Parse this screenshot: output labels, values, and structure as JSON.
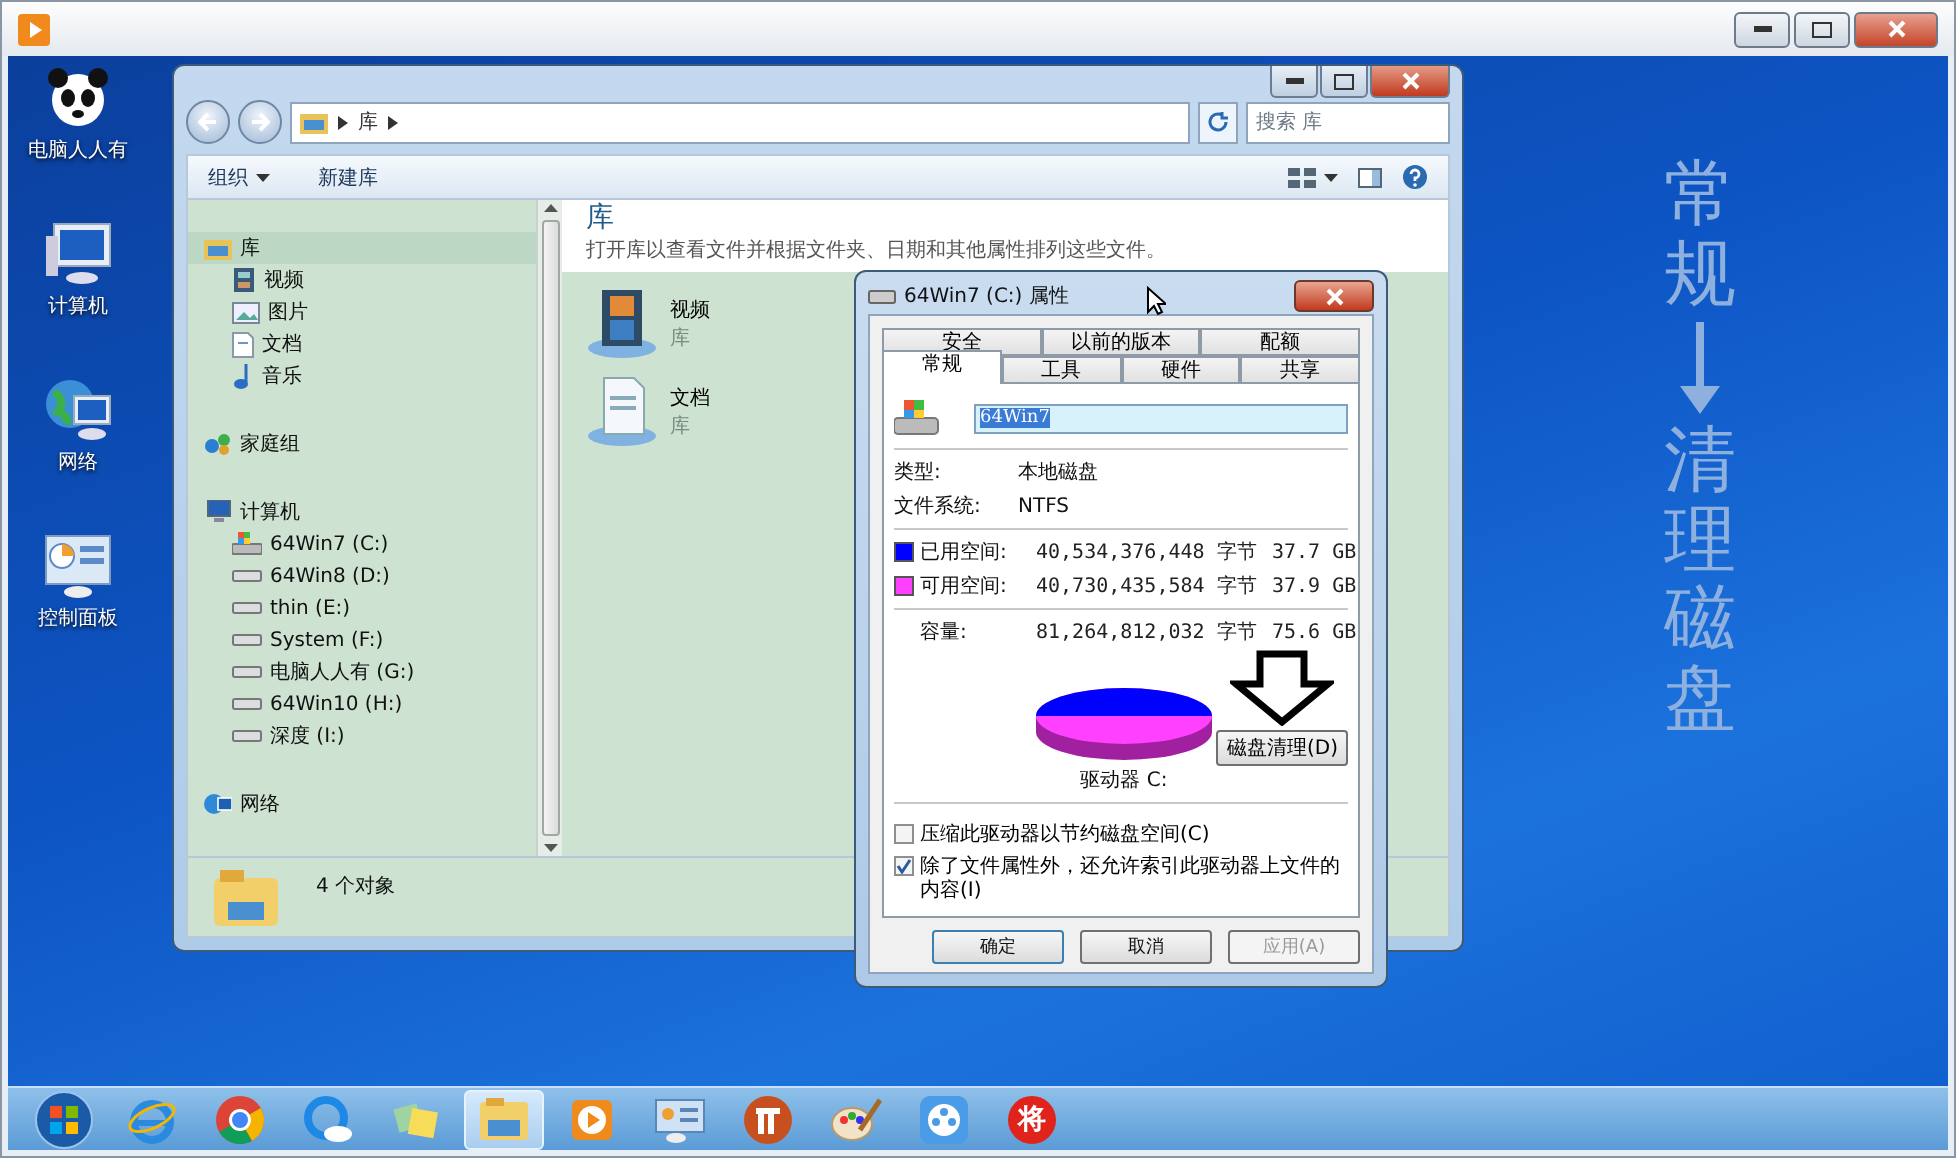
{
  "desktop": {
    "icons": [
      {
        "label": "电脑人人有",
        "kind": "panda"
      },
      {
        "label": "计算机",
        "kind": "computer"
      },
      {
        "label": "网络",
        "kind": "network"
      },
      {
        "label": "控制面板",
        "kind": "control-panel"
      }
    ],
    "caption": {
      "top": "常规",
      "bottom": "清理磁盘"
    }
  },
  "explorer": {
    "breadcrumb": [
      "库"
    ],
    "search": {
      "placeholder": "搜索 库"
    },
    "toolbar": [
      {
        "label": "组织",
        "kind": "menu"
      },
      {
        "label": "新建库",
        "kind": "plain"
      }
    ],
    "nav": [
      {
        "label": "库",
        "kind": "library",
        "selected": true,
        "children": [
          {
            "label": "视频",
            "kind": "video",
            "selected": false
          },
          {
            "label": "图片",
            "kind": "pictures",
            "selected": false
          },
          {
            "label": "文档",
            "kind": "documents",
            "selected": false
          },
          {
            "label": "音乐",
            "kind": "music",
            "selected": false
          }
        ]
      },
      {
        "label": "家庭组",
        "kind": "homegroup",
        "selected": false
      },
      {
        "label": "计算机",
        "kind": "computer",
        "selected": false,
        "children": [
          {
            "label": "64Win7  (C:)",
            "kind": "system-drive",
            "selected": false
          },
          {
            "label": "64Win8  (D:)",
            "kind": "drive",
            "selected": false
          },
          {
            "label": "thin (E:)",
            "kind": "drive",
            "selected": false
          },
          {
            "label": "System (F:)",
            "kind": "drive",
            "selected": false
          },
          {
            "label": "电脑人人有 (G:)",
            "kind": "drive",
            "selected": false
          },
          {
            "label": "64Win10 (H:)",
            "kind": "drive",
            "selected": false
          },
          {
            "label": "深度 (I:)",
            "kind": "drive",
            "selected": false
          }
        ]
      },
      {
        "label": "网络",
        "kind": "network",
        "selected": false
      }
    ],
    "header": {
      "title": "库",
      "subtitle": "打开库以查看文件并根据文件夹、日期和其他属性排列这些文件。"
    },
    "items": [
      {
        "name": "视频",
        "type": "库",
        "kind": "video"
      },
      {
        "name": "文档",
        "type": "库",
        "kind": "documents"
      }
    ],
    "status": "4 个对象"
  },
  "dialog": {
    "title": "64Win7  (C:) 属性",
    "tab_rows": [
      [
        {
          "label": "安全",
          "selected": false
        },
        {
          "label": "以前的版本",
          "selected": false
        },
        {
          "label": "配额",
          "selected": false
        }
      ],
      [
        {
          "label": "常规",
          "selected": true
        },
        {
          "label": "工具",
          "selected": false
        },
        {
          "label": "硬件",
          "selected": false
        },
        {
          "label": "共享",
          "selected": false
        }
      ]
    ],
    "name_value": "64Win7",
    "info": [
      {
        "label": "类型:",
        "value": "本地磁盘"
      },
      {
        "label": "文件系统:",
        "value": "NTFS"
      }
    ],
    "space": [
      {
        "label": "已用空间:",
        "bytes": "40,534,376,448 字节",
        "size": "37.7 GB",
        "color": "#0000ff"
      },
      {
        "label": "可用空间:",
        "bytes": "40,730,435,584 字节",
        "size": "37.9 GB",
        "color": "#ff40ff"
      }
    ],
    "capacity": {
      "label": "容量:",
      "bytes": "81,264,812,032 字节",
      "size": "75.6 GB"
    },
    "drive_label": "驱动器 C:",
    "cleanup_button": "磁盘清理(D)",
    "options": [
      {
        "label": "压缩此驱动器以节约磁盘空间(C)",
        "checked": false
      },
      {
        "label": "除了文件属性外，还允许索引此驱动器上文件的内容(I)",
        "checked": true
      }
    ],
    "buttons": [
      {
        "label": "确定",
        "disabled": false
      },
      {
        "label": "取消",
        "disabled": false
      },
      {
        "label": "应用(A)",
        "disabled": true
      }
    ]
  },
  "taskbar": [
    {
      "kind": "start",
      "selected": false
    },
    {
      "kind": "ie",
      "selected": false
    },
    {
      "kind": "chrome",
      "selected": false
    },
    {
      "kind": "cloud",
      "selected": false
    },
    {
      "kind": "notes",
      "selected": false
    },
    {
      "kind": "explorer",
      "selected": true
    },
    {
      "kind": "player",
      "selected": false
    },
    {
      "kind": "remote",
      "selected": false
    },
    {
      "kind": "p-app",
      "selected": false
    },
    {
      "kind": "paint",
      "selected": false
    },
    {
      "kind": "video",
      "selected": false
    },
    {
      "kind": "badge",
      "text": "将",
      "selected": false
    }
  ]
}
